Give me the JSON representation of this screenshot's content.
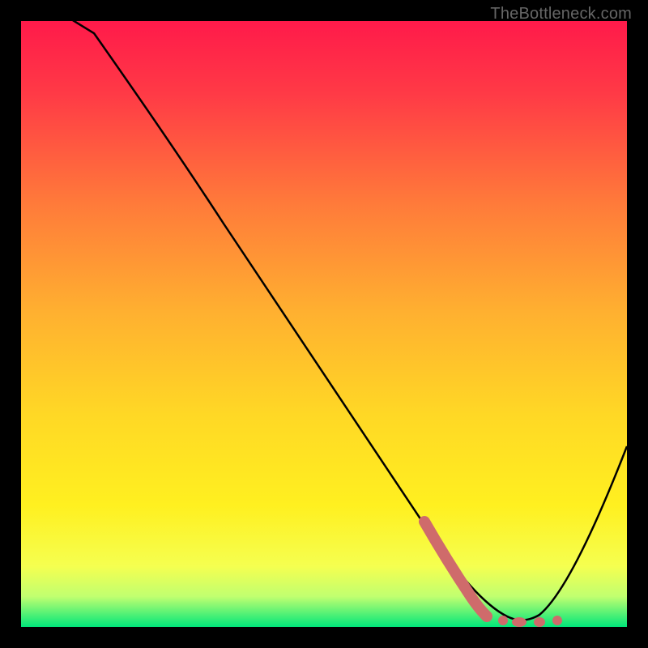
{
  "watermark": "TheBottleneck.com",
  "chart_data": {
    "type": "line",
    "title": "",
    "xlabel": "",
    "ylabel": "",
    "xlim": [
      0,
      100
    ],
    "ylim": [
      0,
      100
    ],
    "background_gradient": {
      "top_color": "#ff1a4a",
      "mid_color": "#ffd500",
      "bottom_color": "#00e67a"
    },
    "series": [
      {
        "name": "curve",
        "type": "line",
        "color": "#000000",
        "x": [
          0,
          12,
          25,
          40,
          55,
          68,
          75,
          80,
          82,
          85,
          90,
          100
        ],
        "y": [
          105,
          98,
          80,
          58,
          36,
          15,
          5,
          1,
          0,
          2,
          10,
          30
        ]
      },
      {
        "name": "marker-segment",
        "type": "line_thick",
        "color": "#d66a6a",
        "x": [
          67,
          72,
          75,
          77
        ],
        "y": [
          16,
          8,
          3,
          1
        ]
      },
      {
        "name": "marker-dots",
        "type": "dots",
        "color": "#d66a6a",
        "x": [
          79,
          81,
          83.5,
          86
        ],
        "y": [
          0.5,
          0.5,
          0.5,
          0.5
        ]
      }
    ]
  }
}
